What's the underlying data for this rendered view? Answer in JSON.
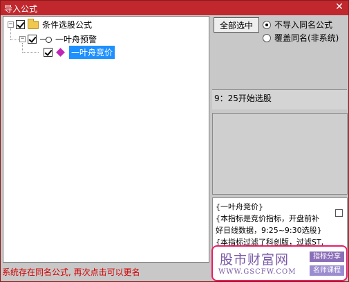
{
  "window": {
    "title": "导入公式",
    "close_glyph": "✕"
  },
  "tree": {
    "root": {
      "expander": "−",
      "label": "条件选股公式",
      "checked": true,
      "icon": "folder-icon"
    },
    "group": {
      "expander": "−",
      "label": "一叶舟预警",
      "checked": true,
      "icon": "key-icon"
    },
    "leaf": {
      "label": "一叶舟竞价",
      "checked": true,
      "icon": "gem-icon",
      "selected": true
    }
  },
  "options": {
    "select_all_label": "全部选中",
    "radio_no_import_label": "不导入同名公式",
    "radio_overwrite_label": "覆盖同名(非系统)",
    "selected_radio": "no_import"
  },
  "info": {
    "text": "9：25开始选股"
  },
  "description": {
    "lines": [
      "{一叶舟竞价}",
      "{本指标是竞价指标，开盘前补",
      "好日线数据，9:25~9:30选股}",
      "{本指标过滤了科创版，过滤ST,"
    ]
  },
  "status_text": "系统存在同名公式, 再次点击可以更名",
  "watermark": {
    "name": "股市财富网",
    "url": "WWW.GSCFW.COM",
    "tag1": "指标分享",
    "tag2": "名师课程"
  }
}
